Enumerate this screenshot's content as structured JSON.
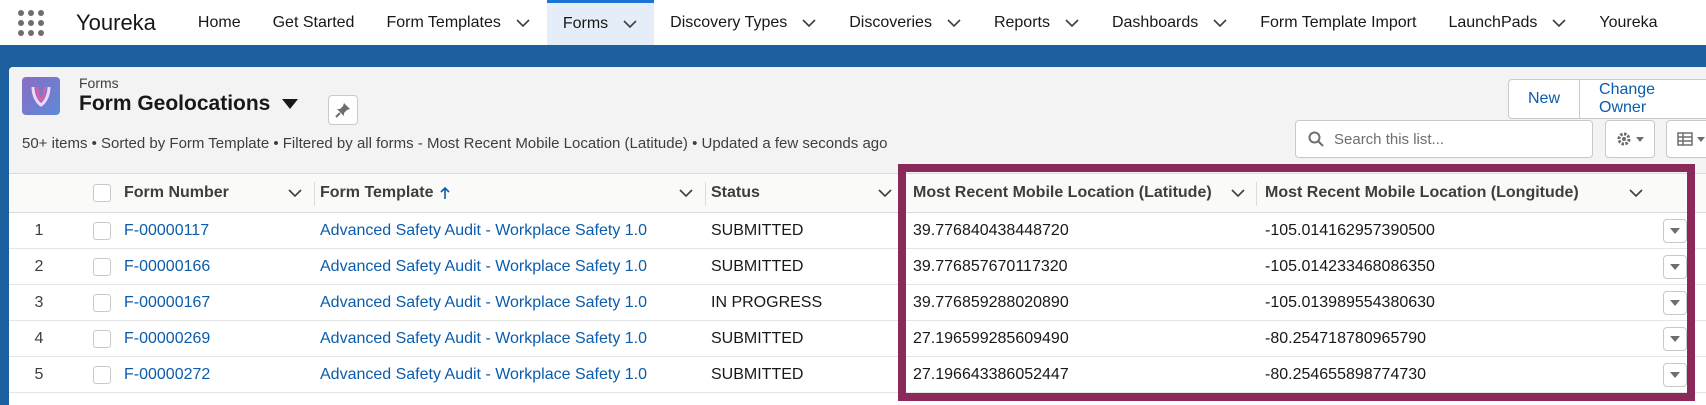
{
  "app": {
    "name": "Youreka"
  },
  "nav": {
    "items": [
      {
        "label": "Home",
        "dropdown": false,
        "active": false
      },
      {
        "label": "Get Started",
        "dropdown": false,
        "active": false
      },
      {
        "label": "Form Templates",
        "dropdown": true,
        "active": false
      },
      {
        "label": "Forms",
        "dropdown": true,
        "active": true
      },
      {
        "label": "Discovery Types",
        "dropdown": true,
        "active": false
      },
      {
        "label": "Discoveries",
        "dropdown": true,
        "active": false
      },
      {
        "label": "Reports",
        "dropdown": true,
        "active": false
      },
      {
        "label": "Dashboards",
        "dropdown": true,
        "active": false
      },
      {
        "label": "Form Template Import",
        "dropdown": false,
        "active": false
      },
      {
        "label": "LaunchPads",
        "dropdown": true,
        "active": false
      },
      {
        "label": "Youreka",
        "dropdown": false,
        "active": false
      }
    ]
  },
  "header": {
    "object_label": "Forms",
    "list_view_title": "Form Geolocations",
    "summary": "50+ items • Sorted by Form Template • Filtered by all forms - Most Recent Mobile Location (Latitude) • Updated a few seconds ago",
    "buttons": {
      "new": "New",
      "change_owner": "Change Owner"
    },
    "search_placeholder": "Search this list..."
  },
  "table": {
    "columns": {
      "form_number": "Form Number",
      "form_template": "Form Template",
      "status": "Status",
      "latitude": "Most Recent Mobile Location (Latitude)",
      "longitude": "Most Recent Mobile Location (Longitude)"
    },
    "sorted_column": "Form Template",
    "sort_direction": "ascending",
    "rows": [
      {
        "num": "1",
        "form_number": "F-00000117",
        "form_template": "Advanced Safety Audit - Workplace Safety 1.0",
        "status": "SUBMITTED",
        "latitude": "39.776840438448720",
        "longitude": "-105.014162957390500"
      },
      {
        "num": "2",
        "form_number": "F-00000166",
        "form_template": "Advanced Safety Audit - Workplace Safety 1.0",
        "status": "SUBMITTED",
        "latitude": "39.776857670117320",
        "longitude": "-105.014233468086350"
      },
      {
        "num": "3",
        "form_number": "F-00000167",
        "form_template": "Advanced Safety Audit - Workplace Safety 1.0",
        "status": "IN PROGRESS",
        "latitude": "39.776859288020890",
        "longitude": "-105.013989554380630"
      },
      {
        "num": "4",
        "form_number": "F-00000269",
        "form_template": "Advanced Safety Audit - Workplace Safety 1.0",
        "status": "SUBMITTED",
        "latitude": "27.196599285609490",
        "longitude": "-80.254718780965790"
      },
      {
        "num": "5",
        "form_number": "F-00000272",
        "form_template": "Advanced Safety Audit - Workplace Safety 1.0",
        "status": "SUBMITTED",
        "latitude": "27.196643386052447",
        "longitude": "-80.254655898774730"
      }
    ]
  },
  "colors": {
    "brand_blue": "#1b5f9e",
    "link": "#0b5cab",
    "highlight_box": "#8b2a5a"
  }
}
